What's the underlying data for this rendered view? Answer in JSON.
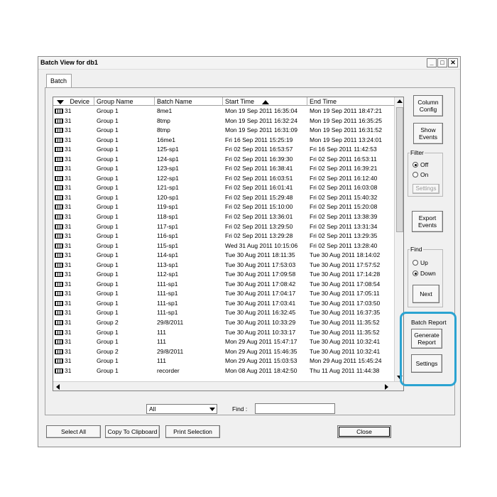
{
  "window": {
    "title": "Batch View for db1",
    "minimize": "_",
    "maximize": "□",
    "close": "✕"
  },
  "tab": {
    "label": "Batch"
  },
  "grid": {
    "headers": {
      "device": "Device",
      "group": "Group Name",
      "batch": "Batch Name",
      "start": "Start Time",
      "end": "End Time"
    },
    "rows": [
      [
        "31",
        "Group 1",
        "8me1",
        "Mon 19 Sep 2011 16:35:04",
        "Mon 19 Sep 2011 18:47:21"
      ],
      [
        "31",
        "Group 1",
        "8tmp",
        "Mon 19 Sep 2011 16:32:24",
        "Mon 19 Sep 2011 16:35:25"
      ],
      [
        "31",
        "Group 1",
        "8tmp",
        "Mon 19 Sep 2011 16:31:09",
        "Mon 19 Sep 2011 16:31:52"
      ],
      [
        "31",
        "Group 1",
        "16me1",
        "Fri 16 Sep 2011 15:25:19",
        "Mon 19 Sep 2011 13:24:01"
      ],
      [
        "31",
        "Group 1",
        "125-sp1",
        "Fri 02 Sep 2011 16:53:57",
        "Fri 16 Sep 2011 11:42:53"
      ],
      [
        "31",
        "Group 1",
        "124-sp1",
        "Fri 02 Sep 2011 16:39:30",
        "Fri 02 Sep 2011 16:53:11"
      ],
      [
        "31",
        "Group 1",
        "123-sp1",
        "Fri 02 Sep 2011 16:38:41",
        "Fri 02 Sep 2011 16:39:21"
      ],
      [
        "31",
        "Group 1",
        "122-sp1",
        "Fri 02 Sep 2011 16:03:51",
        "Fri 02 Sep 2011 16:12:40"
      ],
      [
        "31",
        "Group 1",
        "121-sp1",
        "Fri 02 Sep 2011 16:01:41",
        "Fri 02 Sep 2011 16:03:08"
      ],
      [
        "31",
        "Group 1",
        "120-sp1",
        "Fri 02 Sep 2011 15:29:48",
        "Fri 02 Sep 2011 15:40:32"
      ],
      [
        "31",
        "Group 1",
        "119-sp1",
        "Fri 02 Sep 2011 15:10:00",
        "Fri 02 Sep 2011 15:20:08"
      ],
      [
        "31",
        "Group 1",
        "118-sp1",
        "Fri 02 Sep 2011 13:36:01",
        "Fri 02 Sep 2011 13:38:39"
      ],
      [
        "31",
        "Group 1",
        "117-sp1",
        "Fri 02 Sep 2011 13:29:50",
        "Fri 02 Sep 2011 13:31:34"
      ],
      [
        "31",
        "Group 1",
        "116-sp1",
        "Fri 02 Sep 2011 13:29:28",
        "Fri 02 Sep 2011 13:29:35"
      ],
      [
        "31",
        "Group 1",
        "115-sp1",
        "Wed 31 Aug 2011 10:15:06",
        "Fri 02 Sep 2011 13:28:40"
      ],
      [
        "31",
        "Group 1",
        "114-sp1",
        "Tue 30 Aug 2011 18:11:35",
        "Tue 30 Aug 2011 18:14:02"
      ],
      [
        "31",
        "Group 1",
        "113-sp1",
        "Tue 30 Aug 2011 17:53:03",
        "Tue 30 Aug 2011 17:57:52"
      ],
      [
        "31",
        "Group 1",
        "112-sp1",
        "Tue 30 Aug 2011 17:09:58",
        "Tue 30 Aug 2011 17:14:28"
      ],
      [
        "31",
        "Group 1",
        "111-sp1",
        "Tue 30 Aug 2011 17:08:42",
        "Tue 30 Aug 2011 17:08:54"
      ],
      [
        "31",
        "Group 1",
        "111-sp1",
        "Tue 30 Aug 2011 17:04:17",
        "Tue 30 Aug 2011 17:05:11"
      ],
      [
        "31",
        "Group 1",
        "111-sp1",
        "Tue 30 Aug 2011 17:03:41",
        "Tue 30 Aug 2011 17:03:50"
      ],
      [
        "31",
        "Group 1",
        "111-sp1",
        "Tue 30 Aug 2011 16:32:45",
        "Tue 30 Aug 2011 16:37:35"
      ],
      [
        "31",
        "Group 2",
        "29/8/2011",
        "Tue 30 Aug 2011 10:33:29",
        "Tue 30 Aug 2011 11:35:52"
      ],
      [
        "31",
        "Group 1",
        "111",
        "Tue 30 Aug 2011 10:33:17",
        "Tue 30 Aug 2011 11:35:52"
      ],
      [
        "31",
        "Group 1",
        "111",
        "Mon 29 Aug 2011 15:47:17",
        "Tue 30 Aug 2011 10:32:41"
      ],
      [
        "31",
        "Group 2",
        "29/8/2011",
        "Mon 29 Aug 2011 15:46:35",
        "Tue 30 Aug 2011 10:32:41"
      ],
      [
        "31",
        "Group 1",
        "111",
        "Mon 29 Aug 2011 15:03:53",
        "Mon 29 Aug 2011 15:45:24"
      ],
      [
        "31",
        "Group 1",
        "recorder",
        "Mon 08 Aug 2011 18:42:50",
        "Thu 11 Aug 2011 11:44:38"
      ]
    ]
  },
  "side": {
    "column_config": "Column\nConfig",
    "show_events": "Show\nEvents",
    "filter_label": "Filter",
    "filter_off": "Off",
    "filter_on": "On",
    "filter_settings": "Settings",
    "export_events": "Export\nEvents",
    "find_label": "Find",
    "find_up": "Up",
    "find_down": "Down",
    "next": "Next",
    "batch_report_label": "Batch Report",
    "generate_report": "Generate\nReport",
    "report_settings": "Settings"
  },
  "filterbar": {
    "select_value": "All",
    "find_label": "Find :",
    "find_value": ""
  },
  "bottom": {
    "select_all": "Select All",
    "copy_clipboard": "Copy To Clipboard",
    "print_selection": "Print Selection",
    "close": "Close"
  },
  "colors": {
    "highlight": "#2ba3d1"
  }
}
